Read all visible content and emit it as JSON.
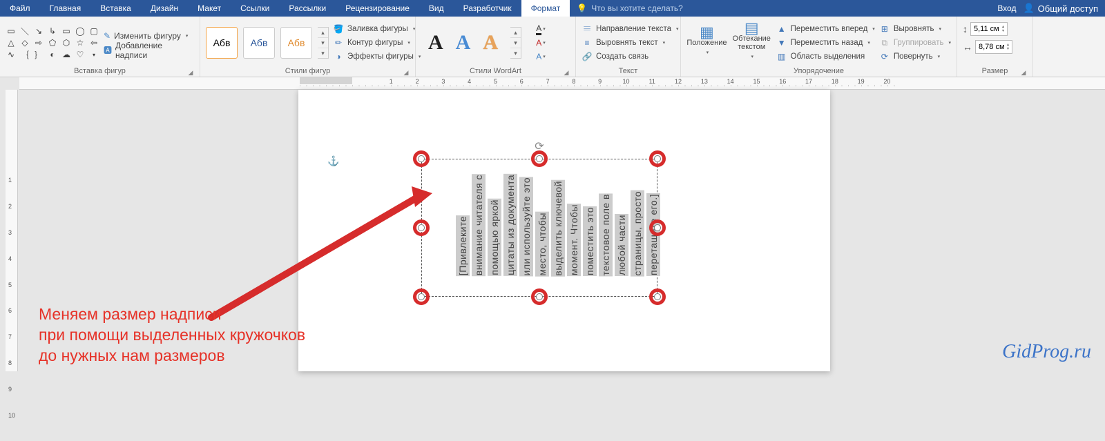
{
  "menubar": {
    "tabs": [
      "Файл",
      "Главная",
      "Вставка",
      "Дизайн",
      "Макет",
      "Ссылки",
      "Рассылки",
      "Рецензирование",
      "Вид",
      "Разработчик",
      "Формат"
    ],
    "active": "Формат",
    "hint": "Что вы хотите сделать?",
    "login": "Вход",
    "share": "Общий доступ"
  },
  "ribbon": {
    "insert_shapes": {
      "title": "Вставка фигур",
      "edit": "Изменить фигуру",
      "textbox": "Добавление надписи"
    },
    "shape_styles": {
      "title": "Стили фигур",
      "sample": "Абв",
      "fill": "Заливка фигуры",
      "outline": "Контур фигуры",
      "effects": "Эффекты фигуры"
    },
    "wordart": {
      "title": "Стили WordArt"
    },
    "text": {
      "title": "Текст",
      "direction": "Направление текста",
      "align": "Выровнять текст",
      "link": "Создать связь"
    },
    "arrange": {
      "title": "Упорядочение",
      "position": "Положение",
      "wrap": "Обтекание текстом",
      "fwd": "Переместить вперед",
      "back": "Переместить назад",
      "pane": "Область выделения",
      "alignbtn": "Выровнять",
      "group": "Группировать",
      "rotate": "Повернуть"
    },
    "size": {
      "title": "Размер",
      "h": "5,11 см",
      "w": "8,78 см"
    }
  },
  "annotation": {
    "l1": "Меняем размер надписи",
    "l2": "при помощи выделенных кружочков",
    "l3": "до нужных нам размеров"
  },
  "textbox_words": [
    "[Привлеките",
    "внимание читателя с",
    "помощью яркой",
    "цитаты из документа",
    "или используйте это",
    "место, чтобы",
    "выделить ключевой",
    "момент. Чтобы",
    "поместить это",
    "текстовое поле в",
    "любой части",
    "страницы, просто",
    "перетащите его.]"
  ],
  "watermark": "GidProg.ru"
}
